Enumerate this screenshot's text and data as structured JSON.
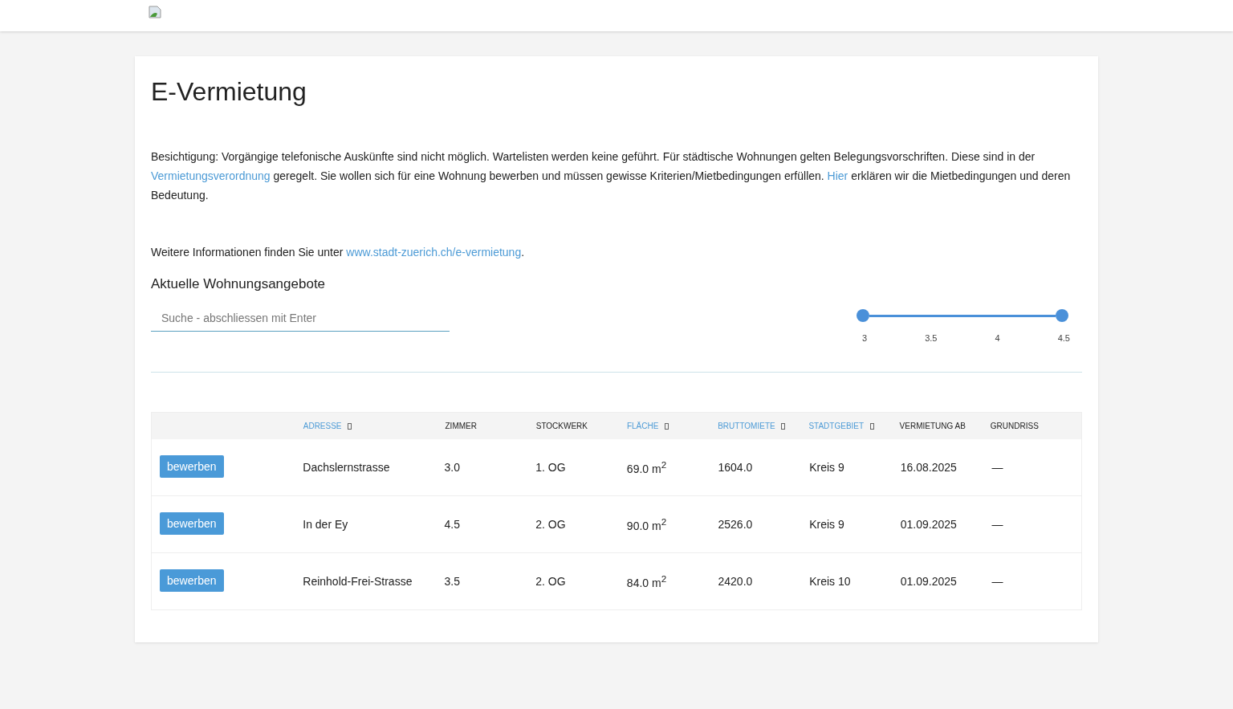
{
  "title": "E-Vermietung",
  "intro": [
    {
      "kind": "text",
      "text": "Besichtigung: Vorgängige telefonische Auskünfte sind nicht möglich. Wartelisten werden keine geführt. Für städtische Wohnungen gelten Belegungsvorschriften. Diese sind in der "
    },
    {
      "kind": "link",
      "text": "Vermietungsverordnung"
    },
    {
      "kind": "text",
      "text": " geregelt. Sie wollen sich für eine Wohnung bewerben und müssen gewisse Kriterien/Mietbedingungen erfüllen. "
    },
    {
      "kind": "link",
      "text": "Hier"
    },
    {
      "kind": "text",
      "text": " erklären wir die Mietbedingungen und deren Bedeutung."
    }
  ],
  "more_info": [
    {
      "kind": "text",
      "text": "Weitere Informationen finden Sie unter "
    },
    {
      "kind": "link",
      "text": "www.stadt-zuerich.ch/e-vermietung"
    },
    {
      "kind": "text",
      "text": "."
    }
  ],
  "section_title": "Aktuelle Wohnungsangebote",
  "search": {
    "placeholder": "Suche - abschliessen mit Enter"
  },
  "rooms_slider": {
    "handles": [
      {
        "level": 0
      },
      {
        "level": 1
      }
    ],
    "ticks": [
      "3",
      "3.5",
      "4",
      "4.5"
    ]
  },
  "table": {
    "columns": [
      {
        "label": "ADRESSE",
        "sortable": true
      },
      {
        "label": "ZIMMER",
        "sortable": false
      },
      {
        "label": "STOCKWERK",
        "sortable": false
      },
      {
        "label": "FLÄCHE",
        "sortable": true
      },
      {
        "label": "BRUTTOMIETE",
        "sortable": true
      },
      {
        "label": "STADTGEBIET",
        "sortable": true
      },
      {
        "label": "VERMIETUNG AB",
        "sortable": false
      },
      {
        "label": "GRUNDRISS",
        "sortable": false
      }
    ],
    "rows": [
      {
        "button": "bewerben",
        "cells": [
          "Dachslernstrasse",
          "3.0",
          "1. OG",
          "69.0 m$^{2}$",
          "1604.0",
          "Kreis 9",
          "16.08.2025",
          "—"
        ]
      },
      {
        "button": "bewerben",
        "cells": [
          "In der Ey",
          "4.5",
          "2. OG",
          "90.0 m$^{2}$",
          "2526.0",
          "Kreis 9",
          "01.09.2025",
          "—"
        ]
      },
      {
        "button": "bewerben",
        "cells": [
          "Reinhold-Frei-Strasse",
          "3.5",
          "2. OG",
          "84.0 m$^{2}$",
          "2420.0",
          "Kreis 10",
          "01.09.2025",
          "—"
        ]
      }
    ]
  }
}
